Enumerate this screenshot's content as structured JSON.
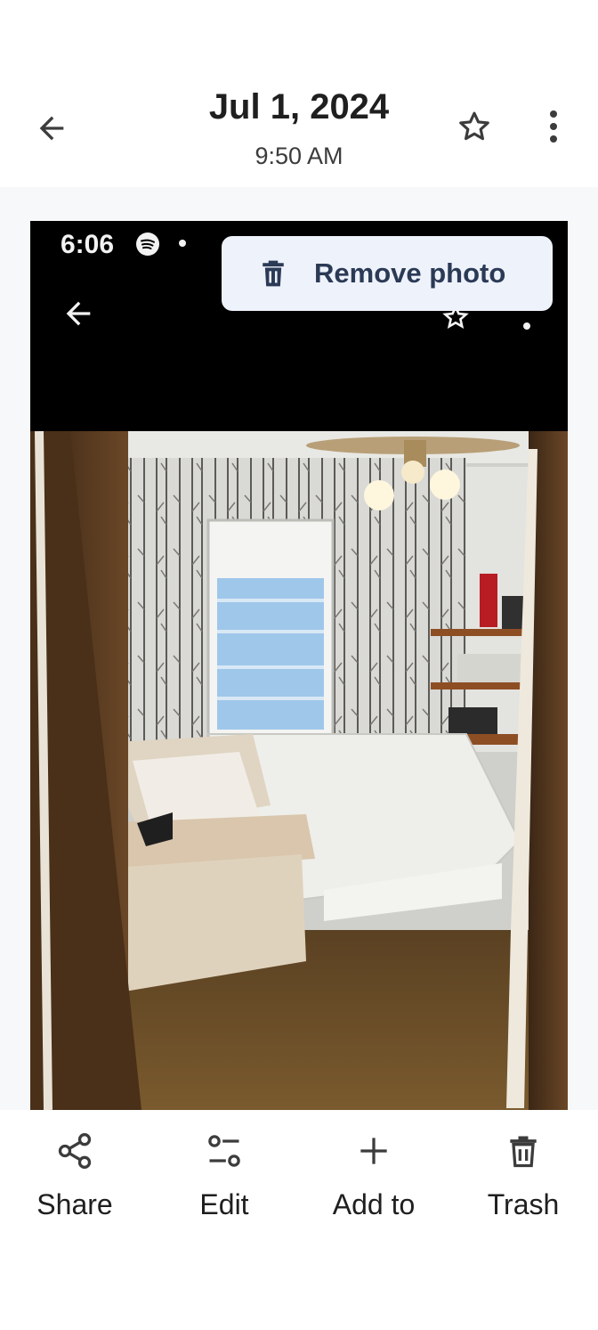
{
  "header": {
    "date": "Jul 1, 2024",
    "time": "9:50 AM"
  },
  "photo": {
    "status_time": "6:06"
  },
  "menu": {
    "remove_label": "Remove photo"
  },
  "actions": [
    {
      "label": "Share",
      "icon": "share-icon"
    },
    {
      "label": "Edit",
      "icon": "edit-icon"
    },
    {
      "label": "Add to",
      "icon": "add-icon"
    },
    {
      "label": "Trash",
      "icon": "trash-icon"
    }
  ],
  "colors": {
    "background": "#ffffff",
    "menu_bg": "#eef2fb",
    "text": "#1f1f1f"
  }
}
